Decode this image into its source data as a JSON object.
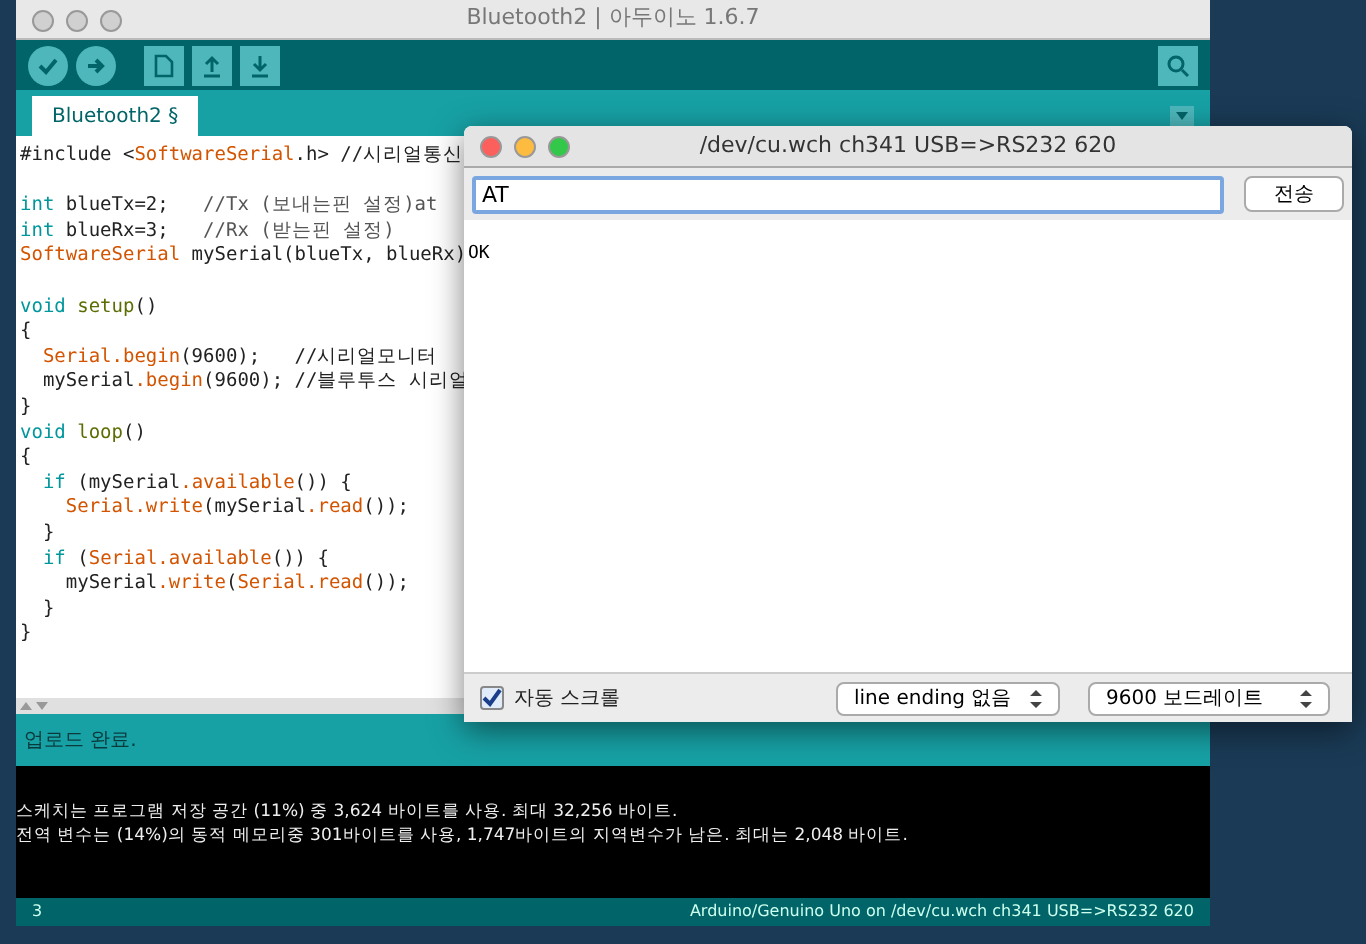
{
  "main_window": {
    "title": "Bluetooth2 | 아두이노 1.6.7",
    "tabs": [
      {
        "label": "Bluetooth2 §",
        "selected": true
      }
    ],
    "code_lines": [
      {
        "tokens": [
          {
            "text": "#include <",
            "kind": "plain"
          },
          {
            "text": "SoftwareSerial",
            "kind": "class"
          },
          {
            "text": ".h> //시리얼통신",
            "kind": "plain"
          }
        ]
      },
      {
        "blank_before": true,
        "tokens": [
          {
            "text": "int",
            "kind": "keyword"
          },
          {
            "text": " blueTx=2;   ",
            "kind": "plain"
          },
          {
            "text": "//Tx (보내는핀 설정)at",
            "kind": "comment"
          }
        ]
      },
      {
        "tokens": [
          {
            "text": "int",
            "kind": "keyword"
          },
          {
            "text": " blueRx=3;   ",
            "kind": "plain"
          },
          {
            "text": "//Rx (받는핀 설정)",
            "kind": "comment"
          }
        ]
      },
      {
        "tokens": [
          {
            "text": "SoftwareSerial",
            "kind": "class"
          },
          {
            "text": " mySerial(blueTx, blueRx)",
            "kind": "plain"
          }
        ]
      },
      {
        "blank_before": true,
        "tokens": [
          {
            "text": "void",
            "kind": "keyword"
          },
          {
            "text": " setup",
            "kind": "function"
          },
          {
            "text": "()",
            "kind": "plain"
          }
        ]
      },
      {
        "tokens": [
          {
            "text": "{",
            "kind": "plain"
          }
        ]
      },
      {
        "tokens": [
          {
            "text": "  Serial.begin",
            "kind": "class"
          },
          {
            "text": "(9600);   //시리얼모니터",
            "kind": "plain"
          }
        ]
      },
      {
        "tokens": [
          {
            "text": "  mySerial",
            "kind": "plain"
          },
          {
            "text": ".begin",
            "kind": "class"
          },
          {
            "text": "(9600); //블루투스 시리얼",
            "kind": "plain"
          }
        ]
      },
      {
        "tokens": [
          {
            "text": "}",
            "kind": "plain"
          }
        ]
      },
      {
        "tokens": [
          {
            "text": "void",
            "kind": "keyword"
          },
          {
            "text": " loop",
            "kind": "function"
          },
          {
            "text": "()",
            "kind": "plain"
          }
        ]
      },
      {
        "tokens": [
          {
            "text": "{",
            "kind": "plain"
          }
        ]
      },
      {
        "tokens": [
          {
            "text": "  if",
            "kind": "keyword"
          },
          {
            "text": " (mySerial",
            "kind": "plain"
          },
          {
            "text": ".available",
            "kind": "class"
          },
          {
            "text": "()) {",
            "kind": "plain"
          }
        ]
      },
      {
        "tokens": [
          {
            "text": "    Serial.write",
            "kind": "class"
          },
          {
            "text": "(mySerial",
            "kind": "plain"
          },
          {
            "text": ".read",
            "kind": "class"
          },
          {
            "text": "());",
            "kind": "plain"
          }
        ]
      },
      {
        "tokens": [
          {
            "text": "  }",
            "kind": "plain"
          }
        ]
      },
      {
        "tokens": [
          {
            "text": "  if",
            "kind": "keyword"
          },
          {
            "text": " (",
            "kind": "plain"
          },
          {
            "text": "Serial.available",
            "kind": "class"
          },
          {
            "text": "()) {",
            "kind": "plain"
          }
        ]
      },
      {
        "tokens": [
          {
            "text": "    mySerial",
            "kind": "plain"
          },
          {
            "text": ".write",
            "kind": "class"
          },
          {
            "text": "(",
            "kind": "plain"
          },
          {
            "text": "Serial.read",
            "kind": "class"
          },
          {
            "text": "());",
            "kind": "plain"
          }
        ]
      },
      {
        "tokens": [
          {
            "text": "  }",
            "kind": "plain"
          }
        ]
      },
      {
        "tokens": [
          {
            "text": "}",
            "kind": "plain"
          }
        ]
      }
    ],
    "message": "업로드 완료.",
    "console": [
      "스케치는 프로그램 저장 공간 (11%) 중 3,624 바이트를 사용. 최대 32,256 바이트.",
      "전역 변수는 (14%)의 동적 메모리중 301바이트를 사용, 1,747바이트의 지역변수가 남은. 최대는 2,048 바이트."
    ],
    "status_bar": {
      "line": "3",
      "board": "Arduino/Genuino Uno on /dev/cu.wch ch341 USB=>RS232 620"
    }
  },
  "serial_monitor": {
    "title": "/dev/cu.wch ch341 USB=>RS232 620",
    "input": "AT",
    "send_button": "전송",
    "output": "OK",
    "autoscroll": {
      "label": "자동 스크롤",
      "checked": true
    },
    "line_ending": "line ending 없음",
    "baud": "9600 보드레이트"
  }
}
